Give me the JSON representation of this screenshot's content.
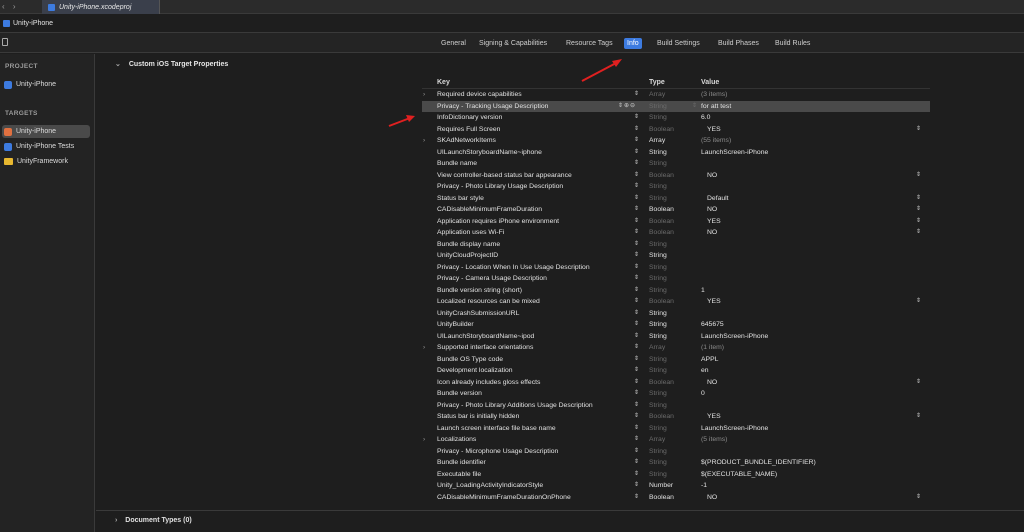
{
  "window": {
    "nav_back": "‹",
    "nav_forward": "›",
    "file_tab": "Unity-iPhone.xcodeproj",
    "project_name": "Unity-iPhone"
  },
  "tabs": [
    {
      "label": "General",
      "active": false
    },
    {
      "label": "Signing & Capabilities",
      "active": false
    },
    {
      "label": "Resource Tags",
      "active": false
    },
    {
      "label": "Info",
      "active": true
    },
    {
      "label": "Build Settings",
      "active": false
    },
    {
      "label": "Build Phases",
      "active": false
    },
    {
      "label": "Build Rules",
      "active": false
    }
  ],
  "sidebar": {
    "project_header": "PROJECT",
    "project_item": "Unity-iPhone",
    "targets_header": "TARGETS",
    "targets": [
      {
        "label": "Unity-iPhone",
        "icon": "unity-app-icon",
        "selected": true
      },
      {
        "label": "Unity-iPhone Tests",
        "icon": "test-target-icon",
        "selected": false
      },
      {
        "label": "UnityFramework",
        "icon": "framework-icon",
        "selected": false
      }
    ]
  },
  "main": {
    "section_title": "Custom iOS Target Properties",
    "columns": {
      "key": "Key",
      "type": "Type",
      "value": "Value"
    },
    "rows": [
      {
        "exp": "›",
        "key": "Required device capabilities",
        "type": "Array",
        "type_dim": true,
        "value": "(3 items)",
        "value_dim": true,
        "popup": false,
        "hl": false
      },
      {
        "exp": "",
        "key": "Privacy - Tracking Usage Description",
        "type": "String",
        "type_dim": true,
        "value": "for att test",
        "value_dim": false,
        "popup": false,
        "hl": true
      },
      {
        "exp": "",
        "key": "InfoDictionary version",
        "type": "String",
        "type_dim": true,
        "value": "6.0",
        "value_dim": false,
        "popup": false,
        "hl": false
      },
      {
        "exp": "",
        "key": "Requires Full Screen",
        "type": "Boolean",
        "type_dim": true,
        "value": "YES",
        "value_dim": false,
        "popup": true,
        "hl": false
      },
      {
        "exp": "›",
        "key": "SKAdNetworkItems",
        "type": "Array",
        "type_dim": false,
        "value": "(55 items)",
        "value_dim": true,
        "popup": false,
        "hl": false
      },
      {
        "exp": "",
        "key": "UILaunchStoryboardName~iphone",
        "type": "String",
        "type_dim": false,
        "value": "LaunchScreen-iPhone",
        "value_dim": false,
        "popup": false,
        "hl": false
      },
      {
        "exp": "",
        "key": "Bundle name",
        "type": "String",
        "type_dim": true,
        "value": "",
        "value_dim": false,
        "popup": false,
        "hl": false
      },
      {
        "exp": "",
        "key": "View controller-based status bar appearance",
        "type": "Boolean",
        "type_dim": true,
        "value": "NO",
        "value_dim": false,
        "popup": true,
        "hl": false
      },
      {
        "exp": "",
        "key": "Privacy - Photo Library Usage Description",
        "type": "String",
        "type_dim": true,
        "value": "",
        "value_dim": false,
        "popup": false,
        "hl": false
      },
      {
        "exp": "",
        "key": "Status bar style",
        "type": "String",
        "type_dim": true,
        "value": "Default",
        "value_dim": false,
        "popup": true,
        "hl": false
      },
      {
        "exp": "",
        "key": "CADisableMinimumFrameDuration",
        "type": "Boolean",
        "type_dim": false,
        "value": "NO",
        "value_dim": false,
        "popup": true,
        "hl": false
      },
      {
        "exp": "",
        "key": "Application requires iPhone environment",
        "type": "Boolean",
        "type_dim": true,
        "value": "YES",
        "value_dim": false,
        "popup": true,
        "hl": false
      },
      {
        "exp": "",
        "key": "Application uses Wi-Fi",
        "type": "Boolean",
        "type_dim": true,
        "value": "NO",
        "value_dim": false,
        "popup": true,
        "hl": false
      },
      {
        "exp": "",
        "key": "Bundle display name",
        "type": "String",
        "type_dim": true,
        "value": "",
        "value_dim": false,
        "popup": false,
        "hl": false
      },
      {
        "exp": "",
        "key": "UnityCloudProjectID",
        "type": "String",
        "type_dim": false,
        "value": "",
        "value_dim": false,
        "popup": false,
        "hl": false
      },
      {
        "exp": "",
        "key": "Privacy - Location When In Use Usage Description",
        "type": "String",
        "type_dim": true,
        "value": "",
        "value_dim": false,
        "popup": false,
        "hl": false
      },
      {
        "exp": "",
        "key": "Privacy - Camera Usage Description",
        "type": "String",
        "type_dim": true,
        "value": "",
        "value_dim": false,
        "popup": false,
        "hl": false
      },
      {
        "exp": "",
        "key": "Bundle version string (short)",
        "type": "String",
        "type_dim": true,
        "value": "1",
        "value_dim": false,
        "popup": false,
        "hl": false
      },
      {
        "exp": "",
        "key": "Localized resources can be mixed",
        "type": "Boolean",
        "type_dim": true,
        "value": "YES",
        "value_dim": false,
        "popup": true,
        "hl": false
      },
      {
        "exp": "",
        "key": "UnityCrashSubmissionURL",
        "type": "String",
        "type_dim": false,
        "value": "",
        "value_dim": false,
        "popup": false,
        "hl": false
      },
      {
        "exp": "",
        "key": "UnityBuilder",
        "type": "String",
        "type_dim": false,
        "value": "645675",
        "value_dim": false,
        "popup": false,
        "hl": false
      },
      {
        "exp": "",
        "key": "UILaunchStoryboardName~ipod",
        "type": "String",
        "type_dim": false,
        "value": "LaunchScreen-iPhone",
        "value_dim": false,
        "popup": false,
        "hl": false
      },
      {
        "exp": "›",
        "key": "Supported interface orientations",
        "type": "Array",
        "type_dim": true,
        "value": "(1 item)",
        "value_dim": true,
        "popup": false,
        "hl": false
      },
      {
        "exp": "",
        "key": "Bundle OS Type code",
        "type": "String",
        "type_dim": true,
        "value": "APPL",
        "value_dim": false,
        "popup": false,
        "hl": false
      },
      {
        "exp": "",
        "key": "Development localization",
        "type": "String",
        "type_dim": true,
        "value": "en",
        "value_dim": false,
        "popup": false,
        "hl": false
      },
      {
        "exp": "",
        "key": "Icon already includes gloss effects",
        "type": "Boolean",
        "type_dim": true,
        "value": "NO",
        "value_dim": false,
        "popup": true,
        "hl": false
      },
      {
        "exp": "",
        "key": "Bundle version",
        "type": "String",
        "type_dim": true,
        "value": "0",
        "value_dim": false,
        "popup": false,
        "hl": false
      },
      {
        "exp": "",
        "key": "Privacy - Photo Library Additions Usage Description",
        "type": "String",
        "type_dim": true,
        "value": "",
        "value_dim": false,
        "popup": false,
        "hl": false
      },
      {
        "exp": "",
        "key": "Status bar is initially hidden",
        "type": "Boolean",
        "type_dim": true,
        "value": "YES",
        "value_dim": false,
        "popup": true,
        "hl": false
      },
      {
        "exp": "",
        "key": "Launch screen interface file base name",
        "type": "String",
        "type_dim": true,
        "value": "LaunchScreen-iPhone",
        "value_dim": false,
        "popup": false,
        "hl": false
      },
      {
        "exp": "›",
        "key": "Localizations",
        "type": "Array",
        "type_dim": true,
        "value": "(5 items)",
        "value_dim": true,
        "popup": false,
        "hl": false
      },
      {
        "exp": "",
        "key": "Privacy - Microphone Usage Description",
        "type": "String",
        "type_dim": true,
        "value": "",
        "value_dim": false,
        "popup": false,
        "hl": false
      },
      {
        "exp": "",
        "key": "Bundle identifier",
        "type": "String",
        "type_dim": true,
        "value": "$(PRODUCT_BUNDLE_IDENTIFIER)",
        "value_dim": false,
        "popup": false,
        "hl": false
      },
      {
        "exp": "",
        "key": "Executable file",
        "type": "String",
        "type_dim": true,
        "value": "$(EXECUTABLE_NAME)",
        "value_dim": false,
        "popup": false,
        "hl": false
      },
      {
        "exp": "",
        "key": "Unity_LoadingActivityIndicatorStyle",
        "type": "Number",
        "type_dim": false,
        "value": "-1",
        "value_dim": false,
        "popup": false,
        "hl": false
      },
      {
        "exp": "",
        "key": "CADisableMinimumFrameDurationOnPhone",
        "type": "Boolean",
        "type_dim": false,
        "value": "NO",
        "value_dim": false,
        "popup": true,
        "hl": false
      }
    ],
    "footer_section": "Document Types (0)"
  },
  "colors": {
    "accent": "#3d7be0",
    "annotation_arrow": "#e02020"
  }
}
